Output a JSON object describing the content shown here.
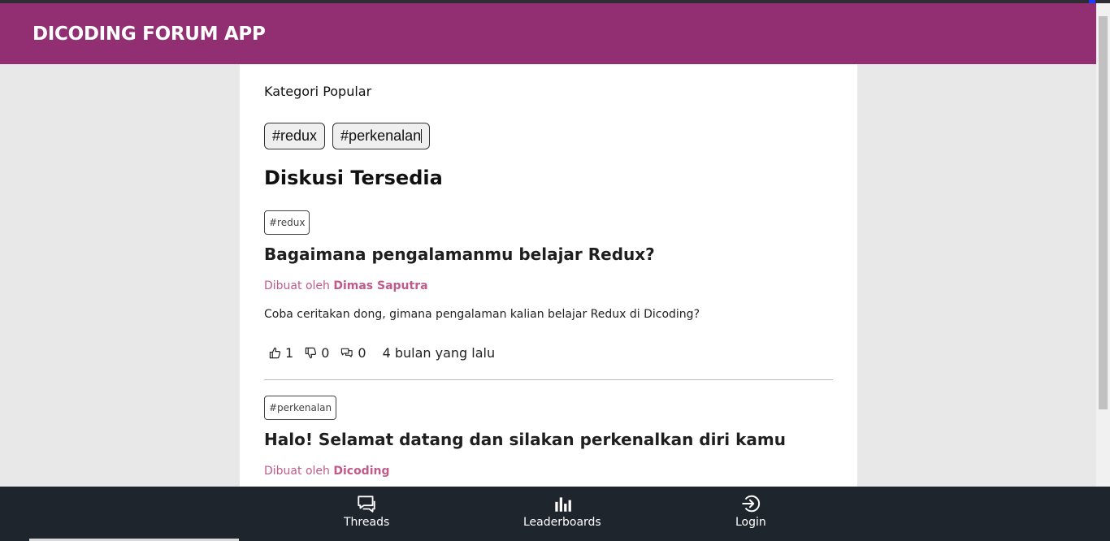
{
  "app": {
    "title": "DICODING FORUM APP"
  },
  "categories": {
    "heading": "Kategori Popular",
    "items": [
      "#redux",
      "#perkenalan"
    ]
  },
  "threads_section": {
    "heading": "Diskusi Tersedia"
  },
  "threads": [
    {
      "category": "#redux",
      "title": "Bagaimana pengalamanmu belajar Redux?",
      "created_by_label": "Dibuat oleh",
      "author": "Dimas Saputra",
      "body": "Coba ceritakan dong, gimana pengalaman kalian belajar Redux di Dicoding?",
      "upvotes": "1",
      "downvotes": "0",
      "comments": "0",
      "time_ago": "4 bulan yang lalu"
    },
    {
      "category": "#perkenalan",
      "title": "Halo! Selamat datang dan silakan perkenalkan diri kamu",
      "created_by_label": "Dibuat oleh",
      "author": "Dicoding"
    }
  ],
  "bottom_nav": {
    "items": [
      {
        "label": "Threads",
        "icon": "threads-icon"
      },
      {
        "label": "Leaderboards",
        "icon": "leaderboards-icon"
      },
      {
        "label": "Login",
        "icon": "login-icon"
      }
    ]
  },
  "colors": {
    "header_bg": "#912f72",
    "author_text": "#c05a8a",
    "bottom_nav_bg": "#1f252d",
    "page_bg": "#e8e8e8"
  }
}
